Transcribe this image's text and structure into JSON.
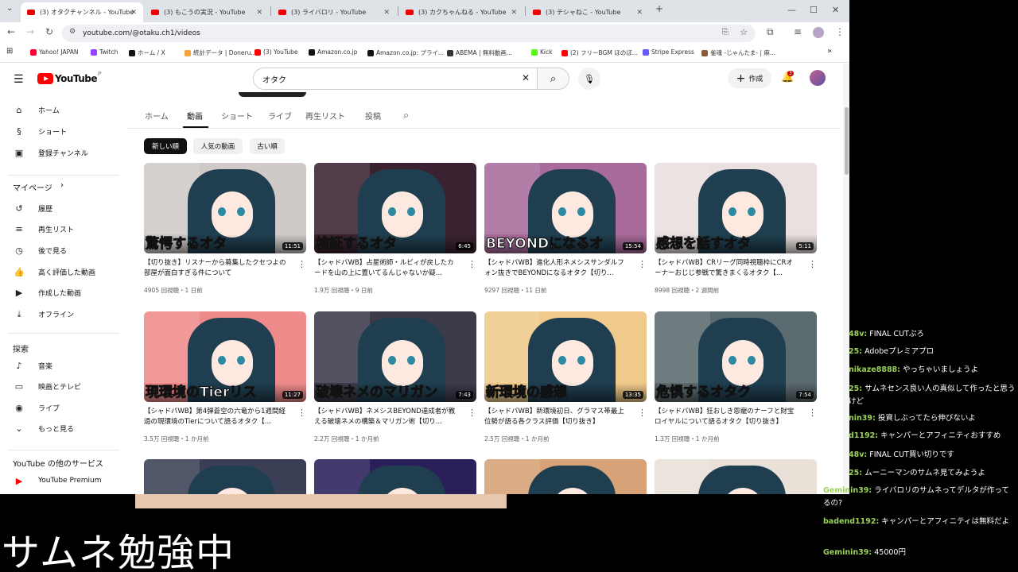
{
  "browser": {
    "tabs": [
      {
        "title": "(3) オタクチャンネル - YouTube",
        "active": true
      },
      {
        "title": "(3) もこうの実況 - YouTube",
        "active": false
      },
      {
        "title": "(3) ライバロリ - YouTube",
        "active": false
      },
      {
        "title": "(3) カクちゃんねる - YouTube",
        "active": false
      },
      {
        "title": "(3) テシャねこ - YouTube",
        "active": false
      }
    ],
    "url": "youtube.com/@otaku.ch1/videos",
    "bookmarks": [
      {
        "label": "Yahoo! JAPAN",
        "color": "#ff0033"
      },
      {
        "label": "Twitch",
        "color": "#9146ff"
      },
      {
        "label": "ホーム / X",
        "color": "#111111"
      },
      {
        "label": "統計データ | Doneru...",
        "color": "#f8a23a"
      },
      {
        "label": "(3) YouTube",
        "color": "#ff0000"
      },
      {
        "label": "Amazon.co.jp",
        "color": "#111111"
      },
      {
        "label": "Amazon.co.jp: プライ...",
        "color": "#111111"
      },
      {
        "label": "ABEMA | 無料動画...",
        "color": "#333333"
      },
      {
        "label": "Kick",
        "color": "#53fc18"
      },
      {
        "label": "(2) フリーBGM ほのぼ...",
        "color": "#ff0000"
      },
      {
        "label": "Stripe Express",
        "color": "#635bff"
      },
      {
        "label": "雀魂 -じゃんたま- | 麻...",
        "color": "#8a5a3a"
      }
    ]
  },
  "youtube": {
    "logo_text": "YouTube",
    "logo_region": "JP",
    "search_value": "オタク",
    "create_label": "作成",
    "notification_count": "3",
    "sidebar": {
      "main": [
        {
          "label": "ホーム",
          "icon": "home-icon"
        },
        {
          "label": "ショート",
          "icon": "shorts-icon"
        },
        {
          "label": "登録チャンネル",
          "icon": "subscriptions-icon"
        }
      ],
      "you_header": "マイページ",
      "you": [
        {
          "label": "履歴",
          "icon": "history-icon"
        },
        {
          "label": "再生リスト",
          "icon": "playlist-icon"
        },
        {
          "label": "後で見る",
          "icon": "watch-later-icon"
        },
        {
          "label": "高く評価した動画",
          "icon": "like-icon"
        },
        {
          "label": "作成した動画",
          "icon": "your-videos-icon"
        },
        {
          "label": "オフライン",
          "icon": "download-icon"
        }
      ],
      "explore_header": "探索",
      "explore": [
        {
          "label": "音楽",
          "icon": "music-icon"
        },
        {
          "label": "映画とテレビ",
          "icon": "movies-icon"
        },
        {
          "label": "ライブ",
          "icon": "live-icon"
        },
        {
          "label": "もっと見る",
          "icon": "chevron-down-icon"
        }
      ],
      "more_header": "YouTube の他のサービス",
      "more": [
        {
          "label": "YouTube Premium",
          "icon": "youtube-premium-icon"
        }
      ]
    },
    "channel_tabs": [
      "ホーム",
      "動画",
      "ショート",
      "ライブ",
      "再生リスト",
      "投稿"
    ],
    "selected_tab": "動画",
    "chips": [
      "新しい順",
      "人気の動画",
      "古い順"
    ],
    "videos": [
      {
        "caption": "驚愕するオタ",
        "duration": "11:51",
        "title": "【切り抜き】リスナーから募集したクセつよの部屋が面白すぎる件について",
        "meta": "4905 回視聴・1 日前",
        "bg": "#cfcac8"
      },
      {
        "caption": "検証するオタ",
        "duration": "6:45",
        "title": "【シャドバWB】占星術師・ルビィが戻したカードを山の上に置いてるんじゃないか疑...",
        "meta": "1.9万 回視聴・9 日前",
        "bg": "#3a2230"
      },
      {
        "caption": "BEYONDになるオ",
        "duration": "15:54",
        "title": "【シャドバWB】進化人形ネメシスサンダルフォン抜きでBEYONDになるオタク【切り...",
        "meta": "9297 回視聴・11 日前",
        "bg": "#a86b9a"
      },
      {
        "caption": "感想を話すオタ",
        "duration": "5:11",
        "title": "【シャドバWB】CRリーグ同時視聴枠にCRオーナーおじじ参戦で驚きまくるオタク【...",
        "meta": "8998 回視聴・2 週間前",
        "bg": "#e9e0df"
      },
      {
        "caption": "現環境のTierリス",
        "duration": "11:27",
        "title": "【シャドバWB】第4弾蒼空の六竜から1週間経過の現環境のTierについて語るオタク【...",
        "meta": "3.5万 回視聴・1 か月前",
        "bg": "#ef8a8a"
      },
      {
        "caption": "破壊ネメのマリガン",
        "duration": "7:43",
        "title": "【シャドバWB】ネメシスBEYOND達成者が教える破壊ネメの構築＆マリガン術【切り...",
        "meta": "2.2万 回視聴・1 か月前",
        "bg": "#3b3b4a"
      },
      {
        "caption": "新環境の感想",
        "duration": "13:35",
        "title": "【シャドバWB】新環境初日、グラマス帯最上位勢が語る各クラス評価【切り抜き】",
        "meta": "2.5万 回視聴・1 か月前",
        "bg": "#f0ca8a"
      },
      {
        "caption": "危惧するオタク",
        "duration": "7:54",
        "title": "【シャドバWB】狂おしき恩寵のナーフと財宝ロイヤルについて語るオタク【切り抜き】",
        "meta": "1.3万 回視聴・1 か月前",
        "bg": "#5b6a6f"
      },
      {
        "caption": "",
        "duration": "",
        "title": "",
        "meta": "",
        "bg": "#3a3f55"
      },
      {
        "caption": "",
        "duration": "",
        "title": "",
        "meta": "",
        "bg": "#2a1f5a"
      },
      {
        "caption": "",
        "duration": "",
        "title": "",
        "meta": "",
        "bg": "#d7a277"
      },
      {
        "caption": "",
        "duration": "",
        "title": "",
        "meta": "",
        "bg": "#e9e1d8"
      }
    ]
  },
  "stream_overlay": {
    "caption": "サムネ勉強中",
    "chat": [
      {
        "user": "48v:",
        "text": "FINAL CUTぷろ"
      },
      {
        "user": "25:",
        "text": "Adobeプレミアプロ"
      },
      {
        "user": "nikaze8888:",
        "text": "やっちゃいましょうよ"
      },
      {
        "user": "25:",
        "text": "サムネセンス良い人の真似して作ったと思うけど"
      },
      {
        "user": "nin39:",
        "text": "投資しぶってたら伸びないよ"
      },
      {
        "user": "d1192:",
        "text": "キャンパーとアフィニティおすすめ"
      },
      {
        "user": "48v:",
        "text": "FINAL CUT買い切りです"
      },
      {
        "user": "25:",
        "text": "ムーニーマンのサムネ見てみようよ"
      },
      {
        "user": "Geminin39:",
        "text": "ライバロリのサムネってデルタが作ってるの?"
      },
      {
        "user": "badend1192:",
        "text": "キャンパーとアフィニティは無料だよ"
      },
      {
        "user": "Geminin39:",
        "text": "45000円"
      }
    ]
  }
}
